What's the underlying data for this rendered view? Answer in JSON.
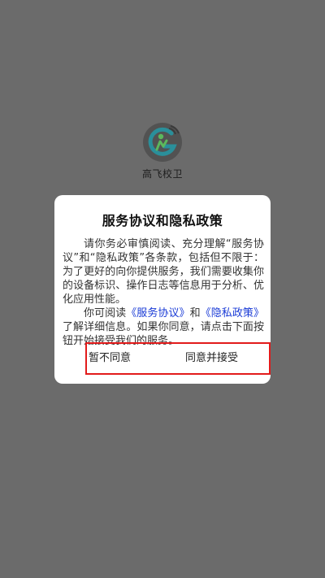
{
  "app": {
    "name": "高飞校卫"
  },
  "dialog": {
    "title": "服务协议和隐私政策",
    "paragraph1": "请你务必审慎阅读、充分理解“服务协议”和“隐私政策”各条款，包括但不限于：为了更好的向你提供服务，我们需要收集你的设备标识、操作日志等信息用于分析、优化应用性能。",
    "p2_prefix": "你可阅读",
    "service_agreement_link": "《服务协议》",
    "p2_and": "和",
    "privacy_policy_link": "《隐私政策》",
    "p2_suffix": "了解详细信息。如果你同意，请点击下面按钮开始接受我们的服务。",
    "disagree_label": "暂不同意",
    "agree_label": "同意并接受"
  },
  "colors": {
    "overlay": "#6b6b6b",
    "link": "#1a3bd6",
    "highlight_border": "#e21b1b",
    "logo_teal": "#2a8f9a",
    "logo_green": "#5cb85c"
  },
  "icons": {
    "logo": "gaofei-logo-icon"
  }
}
